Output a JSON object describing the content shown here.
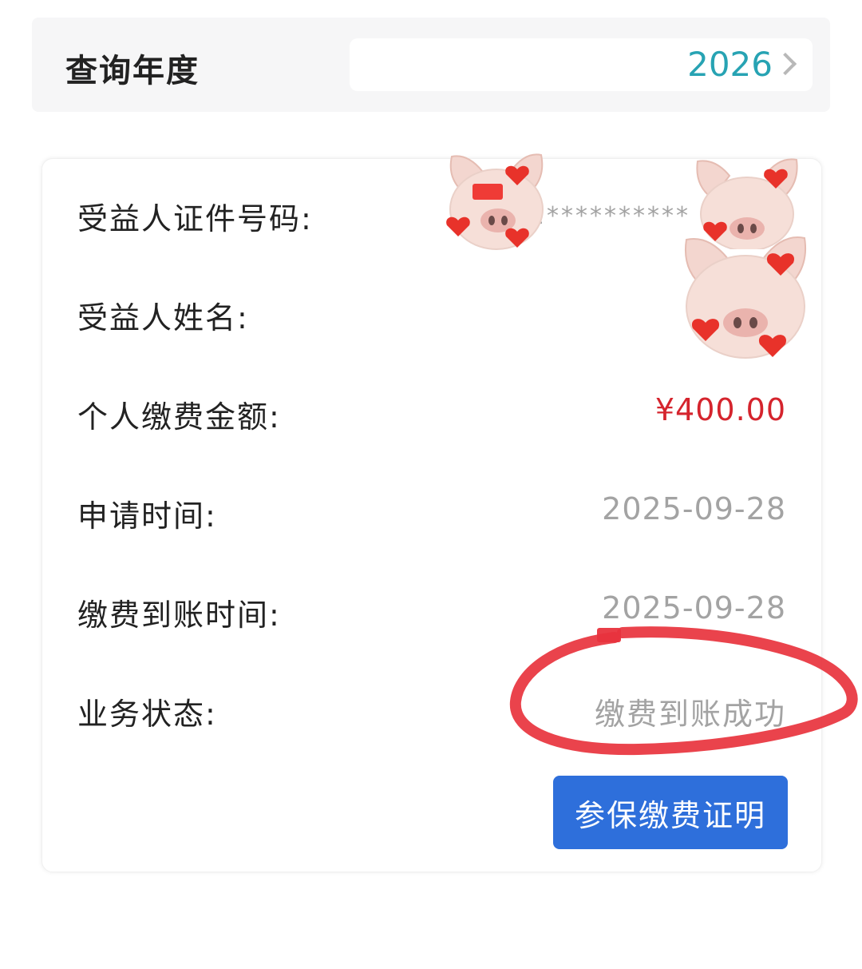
{
  "year_selector": {
    "label": "查询年度",
    "value": "2026"
  },
  "details": {
    "id_number": {
      "label": "受益人证件号码:",
      "value": "2**********"
    },
    "name": {
      "label": "受益人姓名:",
      "value": ""
    },
    "amount": {
      "label": "个人缴费金额:",
      "value": "¥400.00"
    },
    "apply_time": {
      "label": "申请时间:",
      "value": "2025-09-28"
    },
    "arrival_time": {
      "label": "缴费到账时间:",
      "value": "2025-09-28"
    },
    "status": {
      "label": "业务状态:",
      "value": "缴费到账成功"
    }
  },
  "actions": {
    "proof_button": "参保缴费证明"
  },
  "colors": {
    "accent_teal": "#27a3b3",
    "amount_red": "#d5242d",
    "button_blue": "#2e6fdb",
    "annotation_red": "#e8333d"
  },
  "overlays": {
    "stickers": [
      "pig-heart-sticker",
      "pig-heart-sticker",
      "pig-heart-sticker"
    ],
    "annotation": "red-hand-drawn-circle"
  }
}
